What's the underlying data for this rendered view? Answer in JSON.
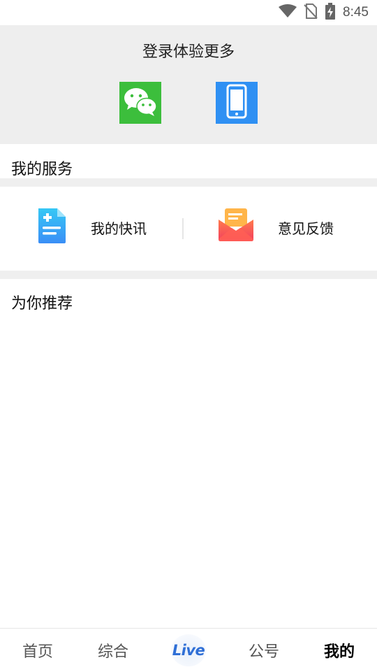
{
  "status_bar": {
    "time": "8:45",
    "icons": [
      "wifi-icon",
      "no-sim-icon",
      "battery-charging-icon"
    ]
  },
  "login": {
    "title": "登录体验更多",
    "options": [
      {
        "icon": "wechat-icon",
        "color": "#3cbe3c"
      },
      {
        "icon": "phone-icon",
        "color": "#2f90f3"
      }
    ]
  },
  "services": {
    "header": "我的服务",
    "items": [
      {
        "label": "我的快讯",
        "icon": "quick-news-icon"
      },
      {
        "label": "意见反馈",
        "icon": "feedback-mail-icon"
      }
    ]
  },
  "recommend": {
    "header": "为你推荐"
  },
  "tab_bar": {
    "tabs": [
      {
        "label": "首页",
        "active": false
      },
      {
        "label": "综合",
        "active": false
      },
      {
        "label": "Live",
        "active": false
      },
      {
        "label": "公号",
        "active": false
      },
      {
        "label": "我的",
        "active": true
      }
    ],
    "live_color": "#2f6fd6"
  }
}
